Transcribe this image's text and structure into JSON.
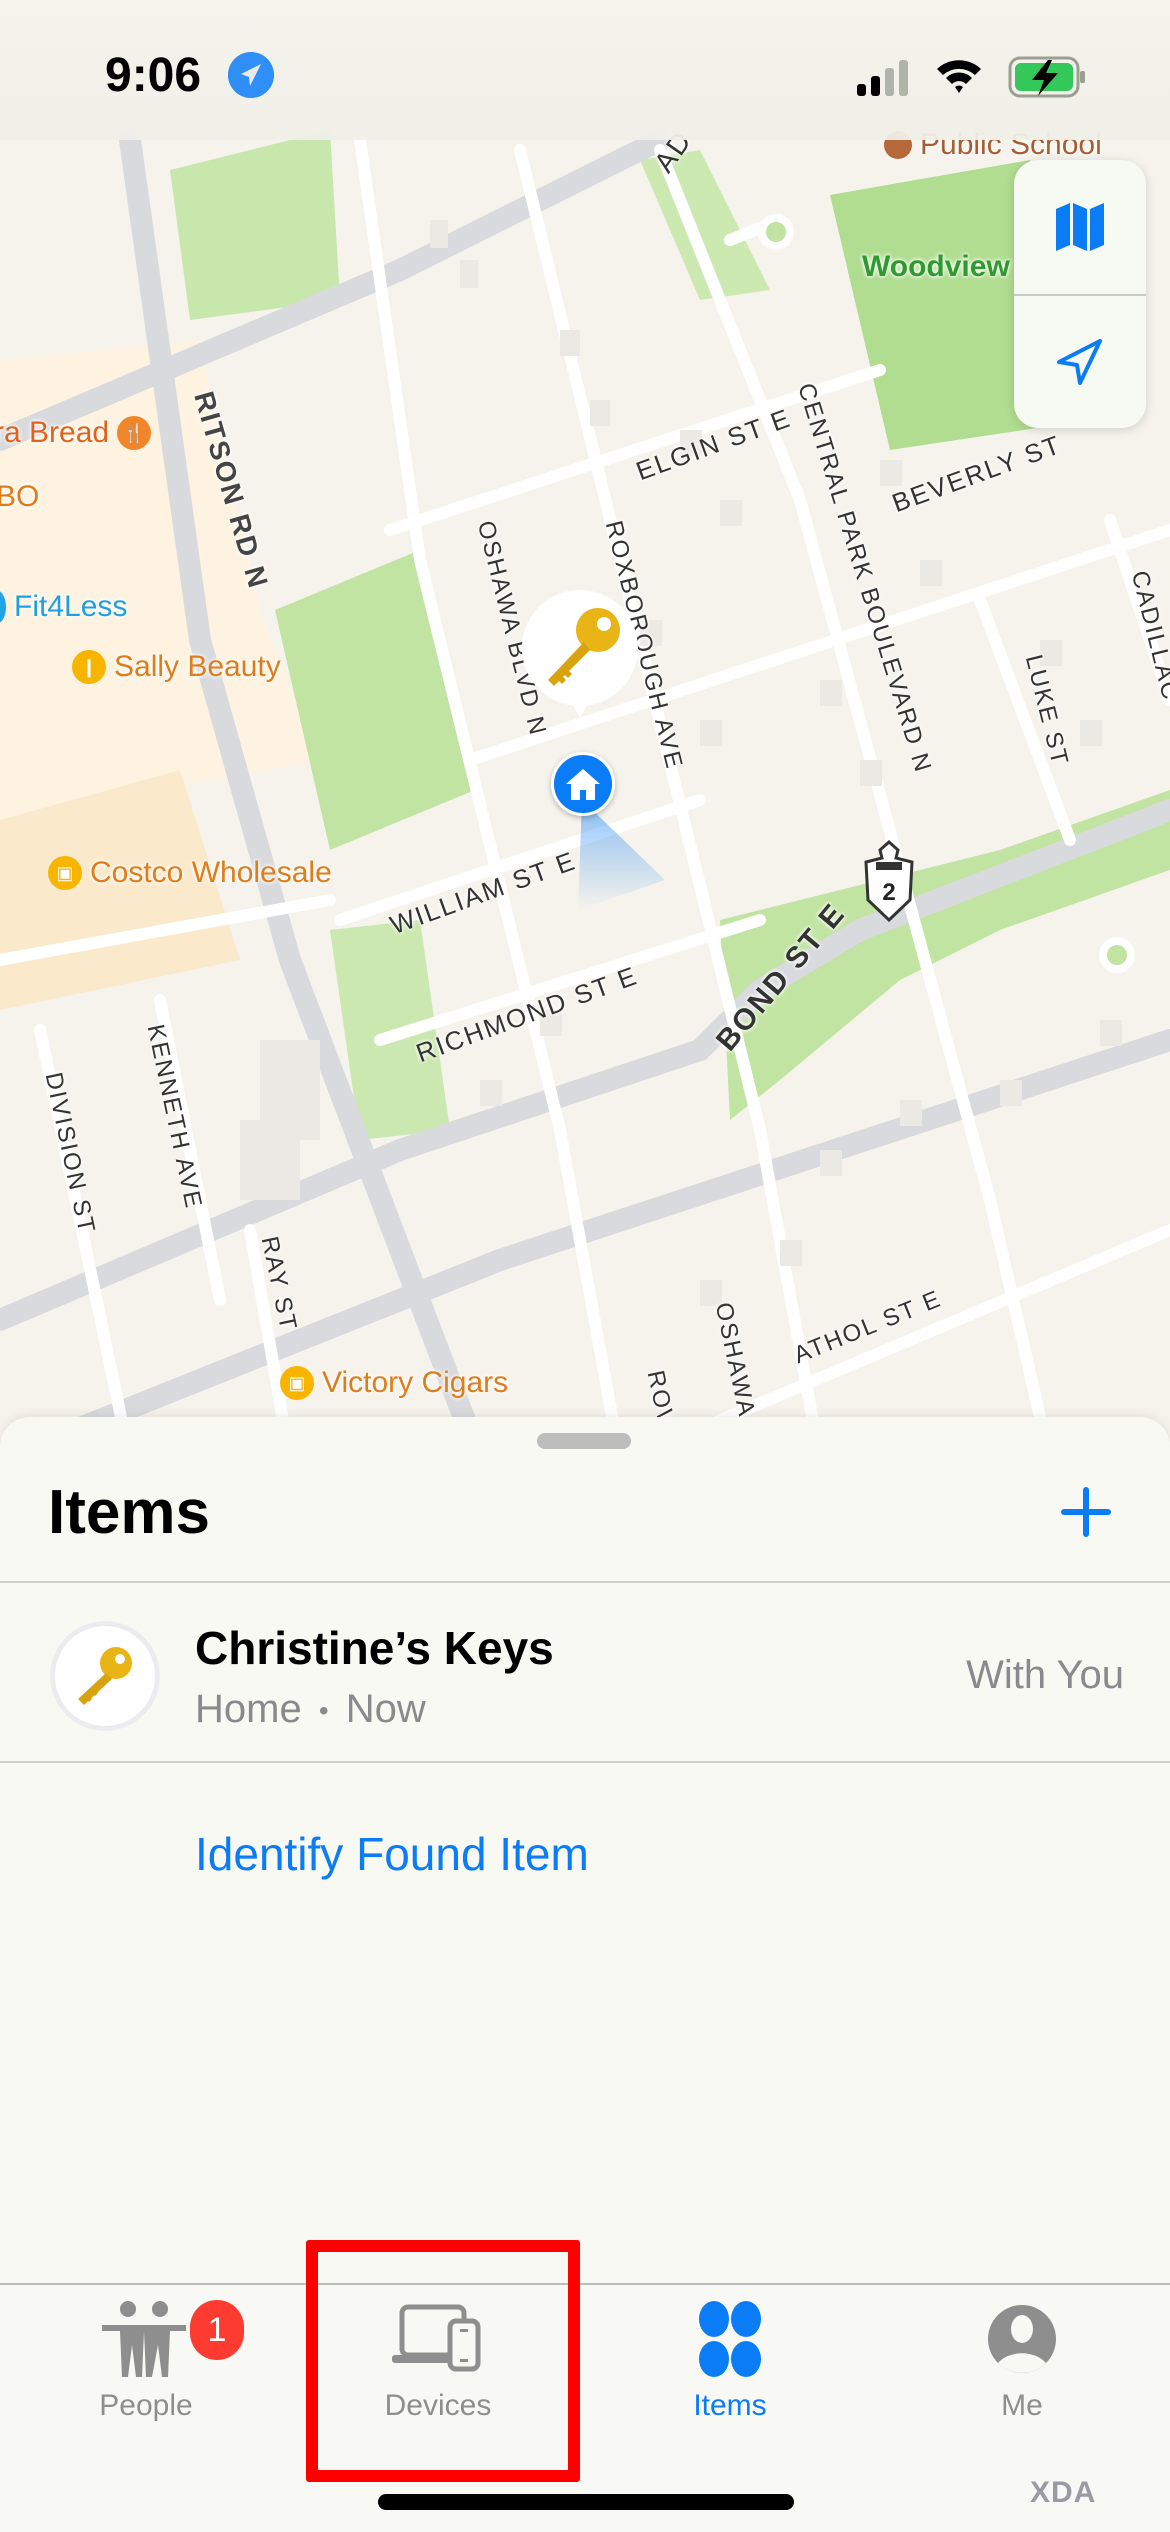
{
  "status_bar": {
    "time": "9:06",
    "location_services_active": true,
    "signal_bars_active": 2,
    "signal_bars_total": 4,
    "battery_state": "charging",
    "battery_color": "#34c759"
  },
  "map": {
    "street_labels": [
      "RITSON RD N",
      "ELGIN ST E",
      "BEVERLY ST",
      "OSHAWA BLVD N",
      "ROXBOROUGH AVE",
      "CENTRAL PARK BOULEVARD N",
      "LUKE ST",
      "CADILLAC",
      "WILLIAM ST E",
      "RICHMOND ST E",
      "BOND ST E",
      "KENNETH AVE",
      "DIVISION ST",
      "RAY ST",
      "ATHOL ST E",
      "OSHAWA",
      "ROW",
      "AD"
    ],
    "pois": [
      {
        "name": "ra Bread",
        "icon": "fork-knife-icon",
        "color": "#f0852a",
        "text_color": "#e2621b"
      },
      {
        "name": "BO",
        "icon": "",
        "color": "#e07b1c",
        "text_color": "#e07b1c"
      },
      {
        "name": "Fit4Less",
        "icon": "dumbbell-icon",
        "color": "#20a4e8",
        "text_color": "#1f9ee2"
      },
      {
        "name": "Sally Beauty",
        "icon": "lipstick-icon",
        "color": "#f7b500",
        "text_color": "#de7d1b"
      },
      {
        "name": "Costco Wholesale",
        "icon": "shopping-bag-icon",
        "color": "#f7b500",
        "text_color": "#de7d1b"
      },
      {
        "name": "Victory Cigars",
        "icon": "shopping-bag-icon",
        "color": "#f7b500",
        "text_color": "#de7d1b"
      },
      {
        "name": "Public School",
        "icon": "school-icon",
        "color": "#b5693b",
        "text_color": "#a85d33"
      },
      {
        "name": "Woodview",
        "icon": "",
        "color": "#2f9a2f",
        "text_color": "#2f9a2f"
      }
    ],
    "highway_shield": "2",
    "pins": {
      "item": "key-emoji",
      "home": "house-icon"
    },
    "controls": {
      "map_mode": "map-icon",
      "locate": "location-arrow-icon",
      "accent": "#0a7cf6"
    }
  },
  "sheet": {
    "title": "Items",
    "add_label": "+",
    "items": [
      {
        "name": "Christine’s Keys",
        "location": "Home",
        "separator": "•",
        "time": "Now",
        "status": "With You",
        "icon": "key-emoji"
      }
    ],
    "identify_link": "Identify Found Item"
  },
  "tab_bar": {
    "tabs": [
      {
        "label": "People",
        "icon": "people-icon",
        "badge": "1",
        "active": false
      },
      {
        "label": "Devices",
        "icon": "devices-icon",
        "active": false,
        "highlighted": true
      },
      {
        "label": "Items",
        "icon": "items-grid-icon",
        "active": true
      },
      {
        "label": "Me",
        "icon": "person-circle-icon",
        "active": false
      }
    ],
    "accent": "#0a7cf6",
    "inactive_color": "#8e8e8e",
    "badge_color": "#fe3b30"
  },
  "annotation": {
    "highlight_color": "#ff0000",
    "target": "Devices"
  },
  "watermark": "XDA"
}
